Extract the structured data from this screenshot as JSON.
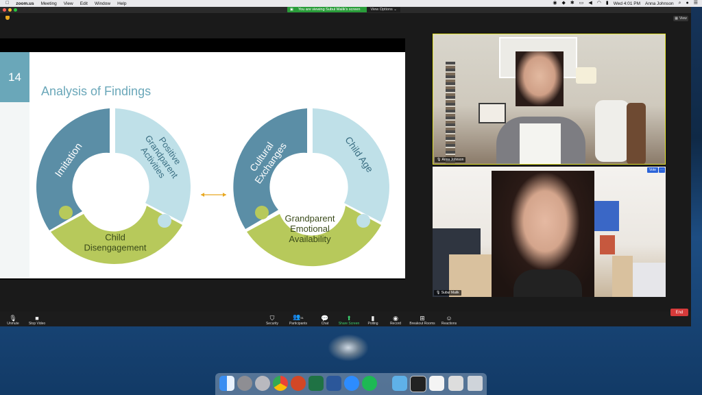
{
  "menubar": {
    "app": "zoom.us",
    "menus": [
      "Meeting",
      "View",
      "Edit",
      "Window",
      "Help"
    ],
    "clock": "Wed 4:01 PM",
    "user": "Anna Johnson"
  },
  "banner": {
    "message": "You are viewing Subul Malik's screen",
    "view_options": "View Options ⌄"
  },
  "view_button": "View",
  "slide": {
    "number": "14",
    "title": "Analysis of Findings",
    "left_cycle": {
      "pieces": [
        "Imitation",
        "Positive Grandparent Activities",
        "Child Disengagement"
      ],
      "colors": [
        "#5b8ea6",
        "#bfe0e8",
        "#b7c95b"
      ]
    },
    "right_cycle": {
      "pieces": [
        "Cultural Exchanges",
        "Child Age",
        "Grandparent Emotional Availability"
      ],
      "colors": [
        "#5b8ea6",
        "#bfe0e8",
        "#b7c95b"
      ]
    },
    "arrow_color": "#e8a820"
  },
  "videos": [
    {
      "name": "Anna Johnson"
    },
    {
      "name": "Subul Malik",
      "view_label": "Vote",
      "more_label": "···"
    }
  ],
  "toolbar": {
    "unmute": "Unmute",
    "stop_video": "Stop Video",
    "security": "Security",
    "participants": "Participants",
    "participants_count": "51",
    "chat": "Chat",
    "share_screen": "Share Screen",
    "polling": "Polling",
    "record": "Record",
    "breakout_rooms": "Breakout Rooms",
    "reactions": "Reactions",
    "end": "End"
  },
  "colors": {
    "share_green": "#2a9d3a",
    "end_red": "#d63a3a",
    "accent_yellow": "#e6e630"
  }
}
